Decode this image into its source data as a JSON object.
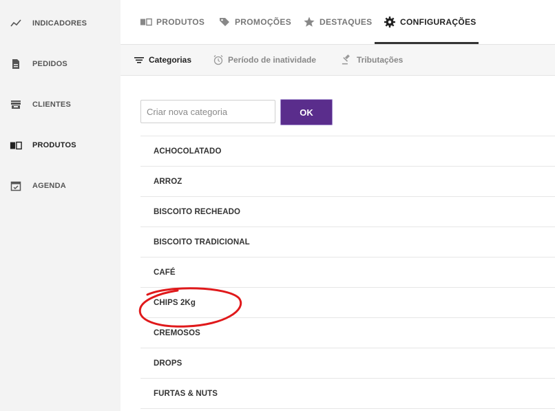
{
  "sidebar": {
    "items": [
      {
        "label": "INDICADORES",
        "icon": "trend-line-icon"
      },
      {
        "label": "PEDIDOS",
        "icon": "document-icon"
      },
      {
        "label": "CLIENTES",
        "icon": "store-icon"
      },
      {
        "label": "PRODUTOS",
        "icon": "book-icon",
        "active": true
      },
      {
        "label": "AGENDA",
        "icon": "calendar-check-icon"
      }
    ]
  },
  "tabs": [
    {
      "label": "PRODUTOS",
      "icon": "book-icon"
    },
    {
      "label": "PROMOÇÕES",
      "icon": "tag-icon"
    },
    {
      "label": "DESTAQUES",
      "icon": "star-icon"
    },
    {
      "label": "CONFIGURAÇÕES",
      "icon": "gear-icon",
      "active": true
    }
  ],
  "subtabs": [
    {
      "label": "Categorias",
      "icon": "list-filter-icon",
      "active": true
    },
    {
      "label": "Período de inatividade",
      "icon": "alarm-clock-icon"
    },
    {
      "label": "Tributações",
      "icon": "gavel-icon"
    }
  ],
  "new_category": {
    "placeholder": "Criar nova categoria",
    "value": "",
    "button_label": "OK"
  },
  "categories": [
    "ACHOCOLATADO",
    "ARROZ",
    "BISCOITO RECHEADO",
    "BISCOITO TRADICIONAL",
    "CAFÉ",
    "CHIPS 2Kg",
    "CREMOSOS",
    "DROPS",
    "FURTAS & NUTS"
  ],
  "highlighted_category": "CHIPS 2Kg",
  "colors": {
    "accent": "#5a2d8c",
    "annotation": "#e0191b",
    "sidebar_bg": "#f3f3f3"
  }
}
